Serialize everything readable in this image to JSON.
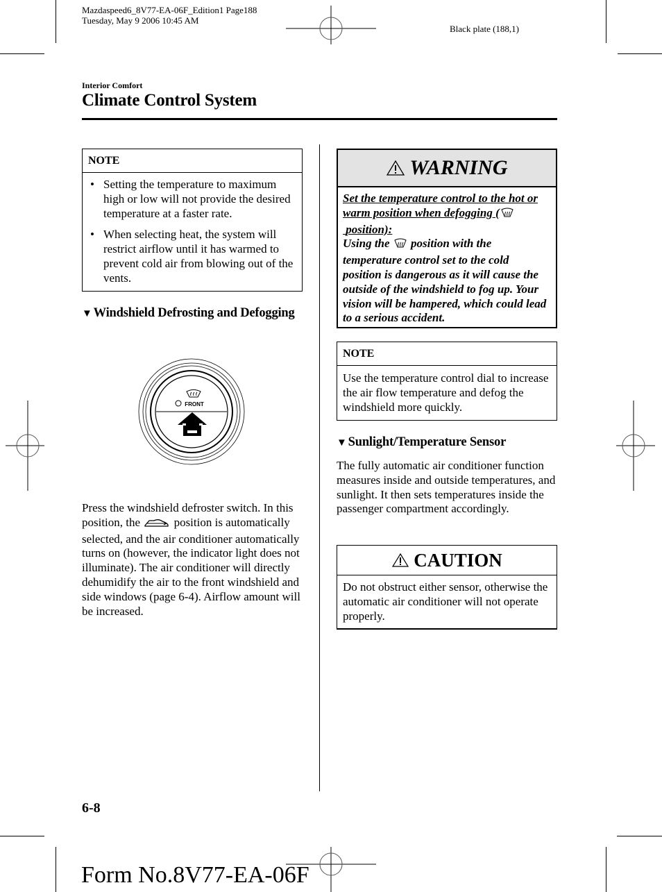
{
  "print_slug": {
    "file_line": "Mazdaspeed6_8V77-EA-06F_Edition1 Page188",
    "date_line": "Tuesday, May 9 2006 10:45 AM",
    "plate": "Black plate (188,1)"
  },
  "header": {
    "section": "Interior Comfort",
    "title": "Climate Control System"
  },
  "left_column": {
    "note1": {
      "heading": "NOTE",
      "bullets": [
        "Setting the temperature to maximum high or low will not provide the desired temperature at a faster rate.",
        "When selecting heat, the system will restrict airflow until it has warmed to prevent cold air from blowing out of the vents."
      ]
    },
    "defrost_section": {
      "heading": "Windshield Defrosting and Defogging",
      "figure": {
        "switch_label": "FRONT",
        "icon": "front-defroster-icon"
      },
      "para_before_icon": "Press the windshield defroster switch. In this position, the",
      "para_icon": "outside-air-icon",
      "para_after_icon": "position is automatically selected, and the air conditioner automatically turns on (however, the indicator light does not illuminate). The air conditioner will directly dehumidify the air to the front windshield and side windows (page 6-4). Airflow amount will be increased."
    }
  },
  "right_column": {
    "warning": {
      "title": "WARNING",
      "icon": "warning-triangle-icon",
      "lead_before_icon": "Set the temperature control to the hot or warm position when defogging (",
      "lead_icon": "front-defroster-icon",
      "lead_after_icon": "position):",
      "body_before_icon": "Using the",
      "body_icon": "front-defroster-icon",
      "body_after_icon": "position with the temperature control set to the cold position is dangerous as it will cause the outside of the windshield to fog up. Your vision will be hampered, which could lead to a serious accident."
    },
    "note2": {
      "heading": "NOTE",
      "body": "Use the temperature control dial to increase the air flow temperature and defog the windshield more quickly."
    },
    "sensor_section": {
      "heading": "Sunlight/Temperature Sensor",
      "body": "The fully automatic air conditioner function measures inside and outside temperatures, and sunlight. It then sets temperatures inside the passenger compartment accordingly."
    },
    "caution": {
      "title": "CAUTION",
      "icon": "warning-triangle-icon",
      "body": "Do not obstruct either sensor, otherwise the automatic air conditioner will not operate properly."
    }
  },
  "footer": {
    "page_number": "6-8",
    "form_number": "Form No.8V77-EA-06F"
  }
}
